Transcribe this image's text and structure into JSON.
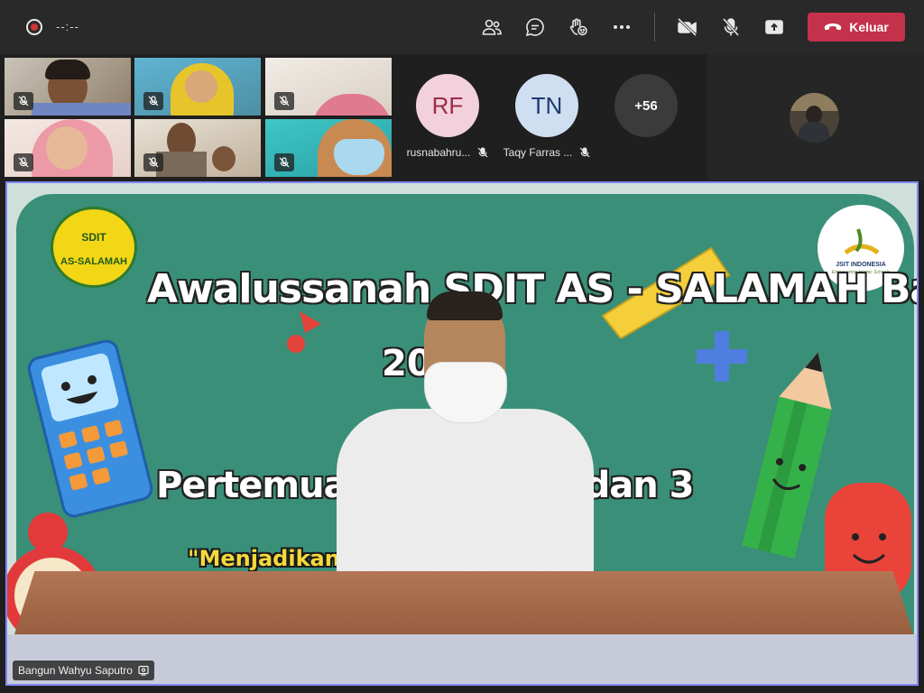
{
  "toolbar": {
    "timer": "--:--",
    "leave_label": "Keluar",
    "icons": [
      "participants-icon",
      "chat-icon",
      "raise-hand-icon",
      "more-options-icon",
      "camera-off-icon",
      "mic-off-icon",
      "share-tray-icon",
      "phone-hangup-icon"
    ],
    "leave_color": "#c4314b"
  },
  "participants": {
    "avatars": [
      {
        "initials": "RF",
        "name": "rusnabahru...",
        "bg": "#f3d1dc",
        "fg": "#9e2a4a"
      },
      {
        "initials": "TN",
        "name": "Taqy Farras ...",
        "bg": "#cfdef0",
        "fg": "#1d3b6e"
      }
    ],
    "more_count": "+56"
  },
  "stage": {
    "presenter_name": "Bangun Wahyu Saputro",
    "slide": {
      "title": "Awalussanah SDIT AS - SALAMAH Baturetno",
      "year": "20     22",
      "subtitle": "Pertemuan Pe                    las 1,2 dan 3",
      "quote": "\"Menjadikan G                        Masa Pandemi\"",
      "logo_left_top": "SDIT",
      "logo_left_bottom": "AS-SALAMAH",
      "logo_right_top": "JSIT INDONESIA",
      "logo_right_bottom": "Empowering Islamic Schools"
    }
  },
  "colors": {
    "accent_border": "#7f85f5",
    "recording": "#d13438"
  }
}
